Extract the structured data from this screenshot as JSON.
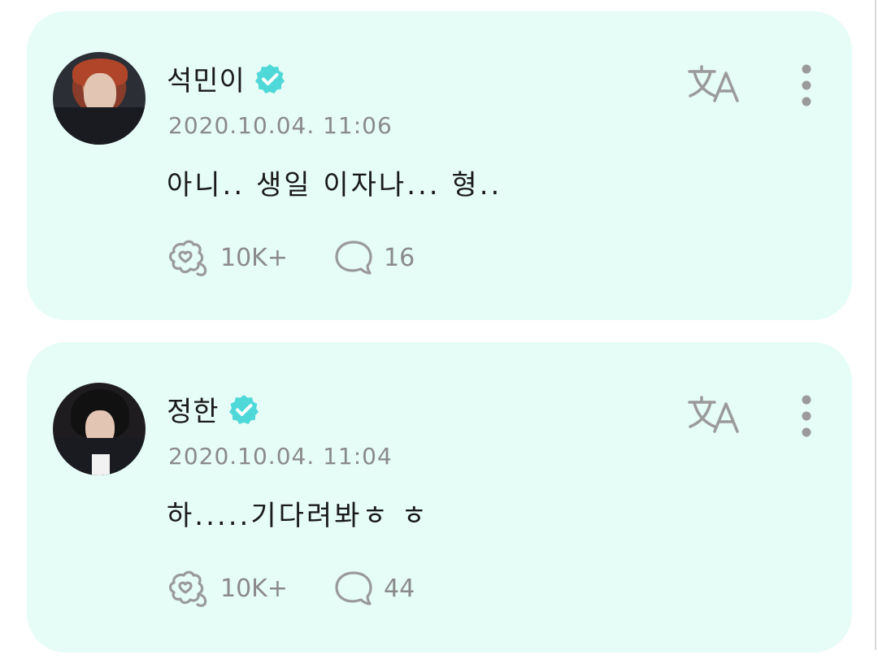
{
  "posts": [
    {
      "author": "석민이",
      "timestamp": "2020.10.04. 11:06",
      "text": "아니.. 생일 이자나... 형..",
      "reactions": "10K+",
      "comments": "16"
    },
    {
      "author": "정한",
      "timestamp": "2020.10.04. 11:04",
      "text": "하.....기다려봐ㅎ ㅎ",
      "reactions": "10K+",
      "comments": "44"
    }
  ],
  "icons": {
    "verified": "verified-badge-icon",
    "translate": "translate-icon",
    "more": "more-vertical-icon",
    "reaction": "heart-bubble-icon",
    "comment": "comment-bubble-icon"
  },
  "colors": {
    "card_background": "#e6fcf6",
    "verified_badge": "#4fd8d8",
    "secondary_text": "#8a8a8a"
  }
}
